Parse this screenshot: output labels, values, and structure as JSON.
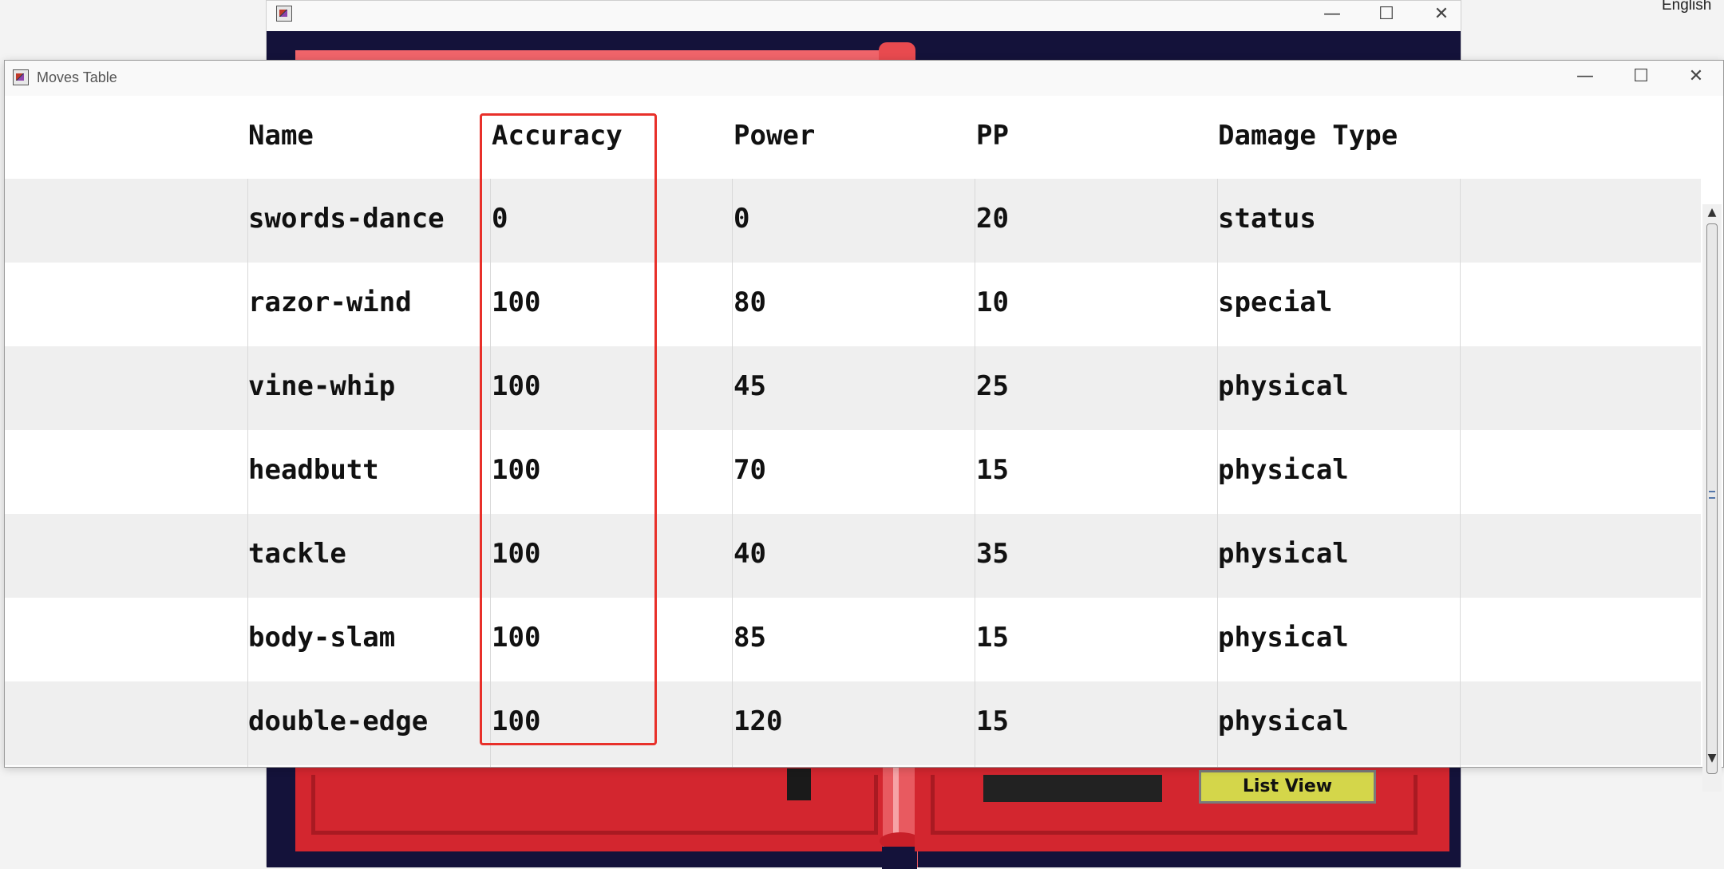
{
  "background_window": {
    "list_view_label": "List View"
  },
  "desktop": {
    "language": "English"
  },
  "moves_window": {
    "title": "Moves Table",
    "columns": [
      "Name",
      "Accuracy",
      "Power",
      "PP",
      "Damage Type"
    ],
    "rows": [
      {
        "name": "swords-dance",
        "accuracy": "0",
        "power": "0",
        "pp": "20",
        "damage_type": "status"
      },
      {
        "name": "razor-wind",
        "accuracy": "100",
        "power": "80",
        "pp": "10",
        "damage_type": "special"
      },
      {
        "name": "vine-whip",
        "accuracy": "100",
        "power": "45",
        "pp": "25",
        "damage_type": "physical"
      },
      {
        "name": "headbutt",
        "accuracy": "100",
        "power": "70",
        "pp": "15",
        "damage_type": "physical"
      },
      {
        "name": "tackle",
        "accuracy": "100",
        "power": "40",
        "pp": "35",
        "damage_type": "physical"
      },
      {
        "name": "body-slam",
        "accuracy": "100",
        "power": "85",
        "pp": "15",
        "damage_type": "physical"
      },
      {
        "name": "double-edge",
        "accuracy": "100",
        "power": "120",
        "pp": "15",
        "damage_type": "physical"
      }
    ],
    "highlighted_column": "Accuracy",
    "highlight_color": "#e8302a"
  }
}
